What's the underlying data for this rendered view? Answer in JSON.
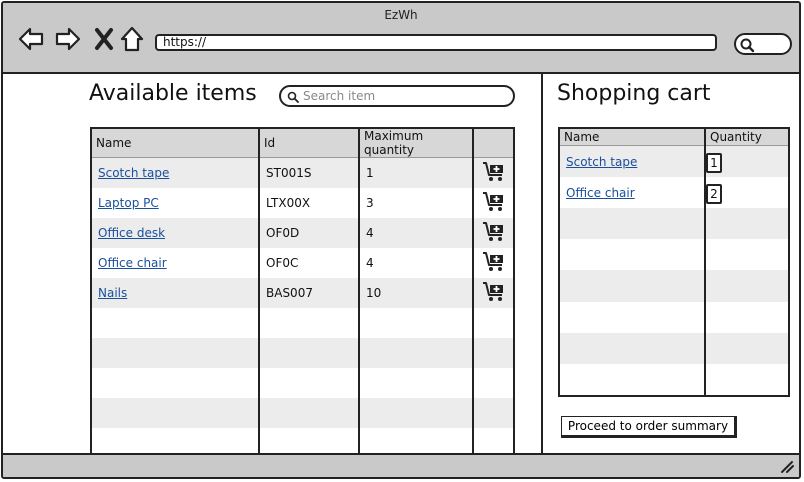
{
  "window": {
    "title": "EzWh"
  },
  "browser": {
    "url": "https://"
  },
  "left": {
    "heading": "Available items",
    "search_placeholder": "Search item",
    "columns": [
      "Name",
      "Id",
      "Maximum quantity",
      ""
    ],
    "items": [
      {
        "name": "Scotch tape",
        "id": "ST001S",
        "max": "1"
      },
      {
        "name": "Laptop PC",
        "id": "LTX00X",
        "max": "3"
      },
      {
        "name": "Office desk",
        "id": "OF0D",
        "max": "4"
      },
      {
        "name": "Office chair",
        "id": "OF0C",
        "max": "4"
      },
      {
        "name": "Nails",
        "id": "BAS007",
        "max": "10"
      }
    ]
  },
  "right": {
    "heading": "Shopping cart",
    "columns": [
      "Name",
      "Quantity"
    ],
    "items": [
      {
        "name": "Scotch tape",
        "qty": "1"
      },
      {
        "name": "Office chair",
        "qty": "2"
      }
    ],
    "proceed_label": "Proceed to order summary"
  },
  "icons": {
    "back": "back-arrow-icon",
    "forward": "forward-arrow-icon",
    "stop": "close-icon",
    "home": "home-icon",
    "search": "search-icon",
    "add_to_cart": "add-to-cart-icon",
    "resize": "resize-grip-icon"
  }
}
